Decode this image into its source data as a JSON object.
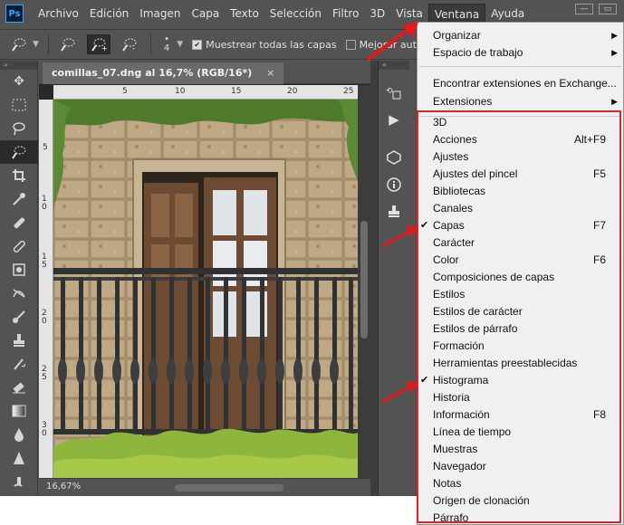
{
  "menubar": {
    "logo": "Ps",
    "items": [
      "Archivo",
      "Edición",
      "Imagen",
      "Capa",
      "Texto",
      "Selección",
      "Filtro",
      "3D",
      "Vista",
      "Ventana",
      "Ayuda"
    ],
    "active": "Ventana"
  },
  "options": {
    "brush_size": "4",
    "sample_all_label": "Muestrear todas las capas",
    "auto_enhance_label": "Mejorar automático"
  },
  "document": {
    "tab_title": "comillas_07.dng al 16,7% (RGB/16*)",
    "close_glyph": "×",
    "zoom": "16,67%",
    "ruler_top": [
      "5",
      "10",
      "15",
      "20",
      "25"
    ],
    "ruler_left": [
      "5",
      "1 0",
      "1 5",
      "2 0",
      "2 5",
      "3 0"
    ]
  },
  "dropdown": {
    "top_items": [
      {
        "label": "Organizar",
        "submenu": true
      },
      {
        "label": "Espacio de trabajo",
        "submenu": true
      }
    ],
    "mid_items": [
      {
        "label": "Encontrar extensiones en Exchange...",
        "submenu": false
      },
      {
        "label": "Extensiones",
        "submenu": true
      }
    ],
    "panel_items": [
      {
        "label": "3D",
        "shortcut": "",
        "checked": false
      },
      {
        "label": "Acciones",
        "shortcut": "Alt+F9",
        "checked": false
      },
      {
        "label": "Ajustes",
        "shortcut": "",
        "checked": false
      },
      {
        "label": "Ajustes del pincel",
        "shortcut": "F5",
        "checked": false
      },
      {
        "label": "Bibliotecas",
        "shortcut": "",
        "checked": false
      },
      {
        "label": "Canales",
        "shortcut": "",
        "checked": false
      },
      {
        "label": "Capas",
        "shortcut": "F7",
        "checked": true
      },
      {
        "label": "Carácter",
        "shortcut": "",
        "checked": false
      },
      {
        "label": "Color",
        "shortcut": "F6",
        "checked": false
      },
      {
        "label": "Composiciones de capas",
        "shortcut": "",
        "checked": false
      },
      {
        "label": "Estilos",
        "shortcut": "",
        "checked": false
      },
      {
        "label": "Estilos de carácter",
        "shortcut": "",
        "checked": false
      },
      {
        "label": "Estilos de párrafo",
        "shortcut": "",
        "checked": false
      },
      {
        "label": "Formación",
        "shortcut": "",
        "checked": false
      },
      {
        "label": "Herramientas preestablecidas",
        "shortcut": "",
        "checked": false
      },
      {
        "label": "Histograma",
        "shortcut": "",
        "checked": true
      },
      {
        "label": "Historia",
        "shortcut": "",
        "checked": false
      },
      {
        "label": "Información",
        "shortcut": "F8",
        "checked": false
      },
      {
        "label": "Línea de tiempo",
        "shortcut": "",
        "checked": false
      },
      {
        "label": "Muestras",
        "shortcut": "",
        "checked": false
      },
      {
        "label": "Navegador",
        "shortcut": "",
        "checked": false
      },
      {
        "label": "Notas",
        "shortcut": "",
        "checked": false
      },
      {
        "label": "Origen de clonación",
        "shortcut": "",
        "checked": false
      },
      {
        "label": "Párrafo",
        "shortcut": "",
        "checked": false
      }
    ],
    "check_glyph": "✔",
    "submenu_glyph": "▶"
  },
  "colors": {
    "ui_gray": "#535353",
    "menu_bg": "#f0f0f0",
    "annotation_red": "#d9262b"
  }
}
